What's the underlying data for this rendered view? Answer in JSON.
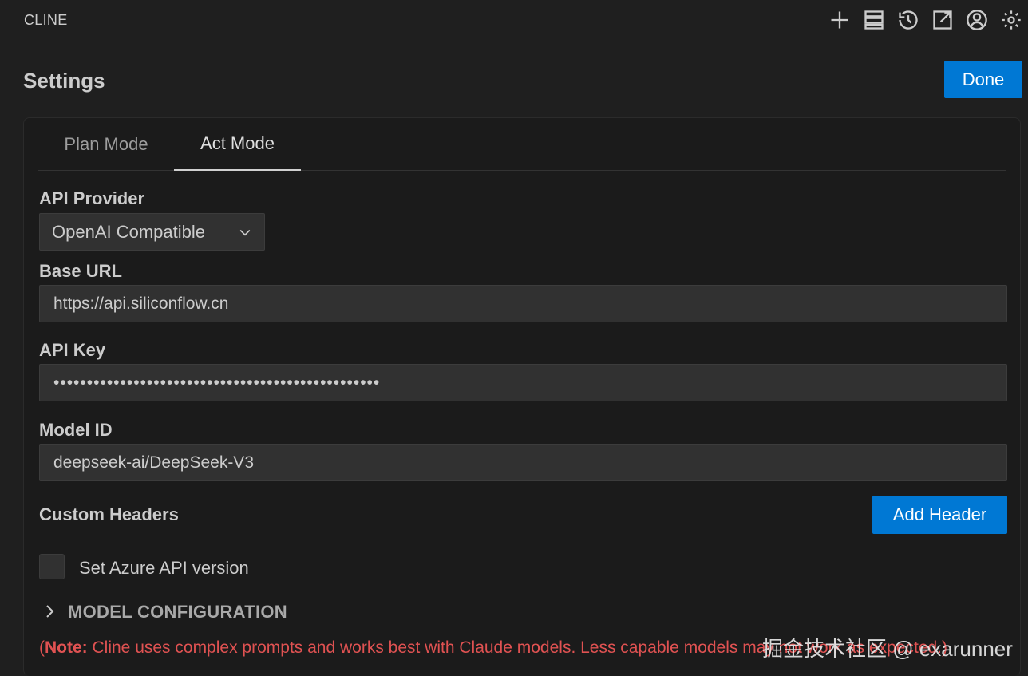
{
  "app": {
    "title": "CLINE"
  },
  "toolbar": {
    "icons": [
      "plus-icon",
      "server-icon",
      "history-icon",
      "popout-icon",
      "account-icon",
      "gear-icon"
    ]
  },
  "header": {
    "title": "Settings",
    "done_label": "Done"
  },
  "tabs": [
    {
      "label": "Plan Mode",
      "active": false
    },
    {
      "label": "Act Mode",
      "active": true
    }
  ],
  "form": {
    "api_provider_label": "API Provider",
    "api_provider_value": "OpenAI Compatible",
    "base_url_label": "Base URL",
    "base_url_value": "https://api.siliconflow.cn",
    "api_key_label": "API Key",
    "api_key_value": "•••••••••••••••••••••••••••••••••••••••••••••••••",
    "model_id_label": "Model ID",
    "model_id_value": "deepseek-ai/DeepSeek-V3",
    "custom_headers_label": "Custom Headers",
    "add_header_label": "Add Header",
    "azure_checkbox_label": "Set Azure API version",
    "azure_checked": false,
    "model_config_label": "MODEL CONFIGURATION"
  },
  "note": {
    "open": "(",
    "prefix": "Note:",
    "text": " Cline uses complex prompts and works best with Claude models. Less capable models may not work as expected.)"
  },
  "watermark": {
    "text": "掘金技术社区 @ exarunner"
  },
  "colors": {
    "accent": "#0078d4",
    "background": "#1f1f1f",
    "note": "#e05252"
  }
}
